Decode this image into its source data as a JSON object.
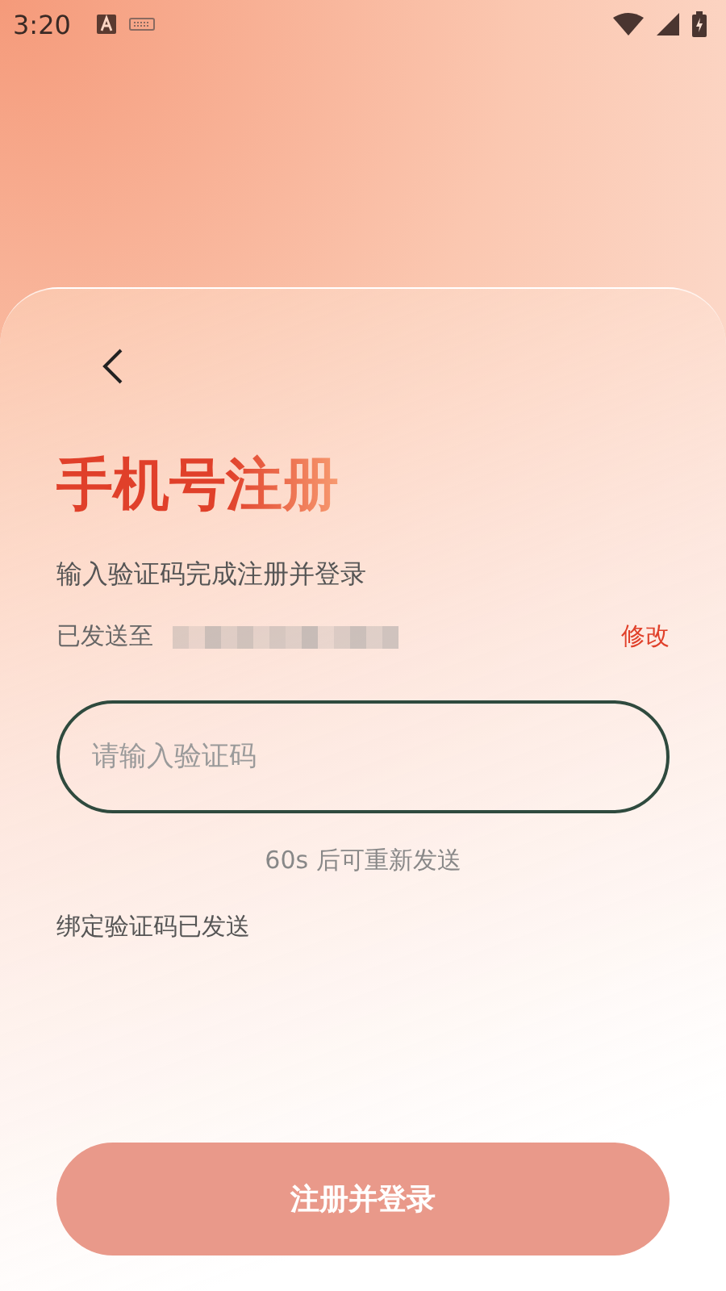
{
  "status_bar": {
    "time": "3:20"
  },
  "title": "手机号注册",
  "subtitle": "输入验证码完成注册并登录",
  "sent_to": {
    "label": "已发送至",
    "edit_link": "修改"
  },
  "code_field": {
    "placeholder": "请输入验证码"
  },
  "resend_hint": "60s 后可重新发送",
  "notice": "绑定验证码已发送",
  "submit_button": {
    "label": "注册并登录",
    "disabled": true
  }
}
